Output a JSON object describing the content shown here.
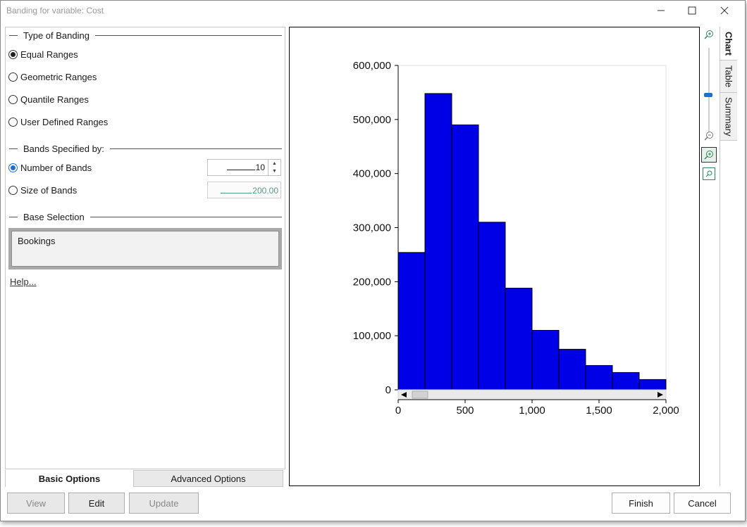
{
  "window": {
    "title": "Banding for variable: Cost",
    "minimize_icon": "minimize-icon",
    "maximize_icon": "maximize-icon",
    "close_icon": "close-icon"
  },
  "type_of_banding": {
    "header": "Type of Banding",
    "options": [
      {
        "label": "Equal Ranges",
        "selected": true
      },
      {
        "label": "Geometric Ranges",
        "selected": false
      },
      {
        "label": "Quantile Ranges",
        "selected": false
      },
      {
        "label": "User Defined Ranges",
        "selected": false
      }
    ]
  },
  "bands_specified": {
    "header": "Bands Specified by:",
    "number_label": "Number of Bands",
    "number_value": "10",
    "number_selected": true,
    "size_label": "Size of Bands",
    "size_value": "200.00",
    "size_selected": false
  },
  "base_selection": {
    "header": "Base Selection",
    "value": "Bookings"
  },
  "help_link": "Help...",
  "bottom_tabs": {
    "basic": "Basic Options",
    "advanced": "Advanced Options",
    "active": "basic"
  },
  "buttons": {
    "view": "View",
    "edit": "Edit",
    "update": "Update",
    "finish": "Finish",
    "cancel": "Cancel"
  },
  "side_tabs": {
    "chart": "Chart",
    "table": "Table",
    "summary": "Summary",
    "active": "chart"
  },
  "toolbar_icons": [
    "zoom-in-icon",
    "zoom-slider",
    "zoom-out-icon",
    "zoom-in-box-icon",
    "zoom-fit-icon"
  ],
  "zoom_level_fraction": 0.5,
  "colors": {
    "bar_fill": "#0000e6",
    "bar_edge": "#000000",
    "accent": "#1f6fd1"
  },
  "chart_data": {
    "type": "bar",
    "title": "",
    "xlabel": "",
    "ylabel": "",
    "bin_edges": [
      0,
      200,
      400,
      600,
      800,
      1000,
      1200,
      1400,
      1600,
      1800,
      2000
    ],
    "values": [
      254000,
      548000,
      490000,
      310000,
      188000,
      110000,
      75000,
      45000,
      32000,
      19000
    ],
    "xlim": [
      0,
      2000
    ],
    "ylim": [
      0,
      600000
    ],
    "x_ticks": [
      "0",
      "500",
      "1,000",
      "1,500",
      "2,000"
    ],
    "x_tick_values": [
      0,
      500,
      1000,
      1500,
      2000
    ],
    "y_ticks": [
      "0",
      "100,000",
      "200,000",
      "300,000",
      "400,000",
      "500,000",
      "600,000"
    ],
    "y_tick_values": [
      0,
      100000,
      200000,
      300000,
      400000,
      500000,
      600000
    ],
    "grid": false,
    "legend": "none"
  }
}
